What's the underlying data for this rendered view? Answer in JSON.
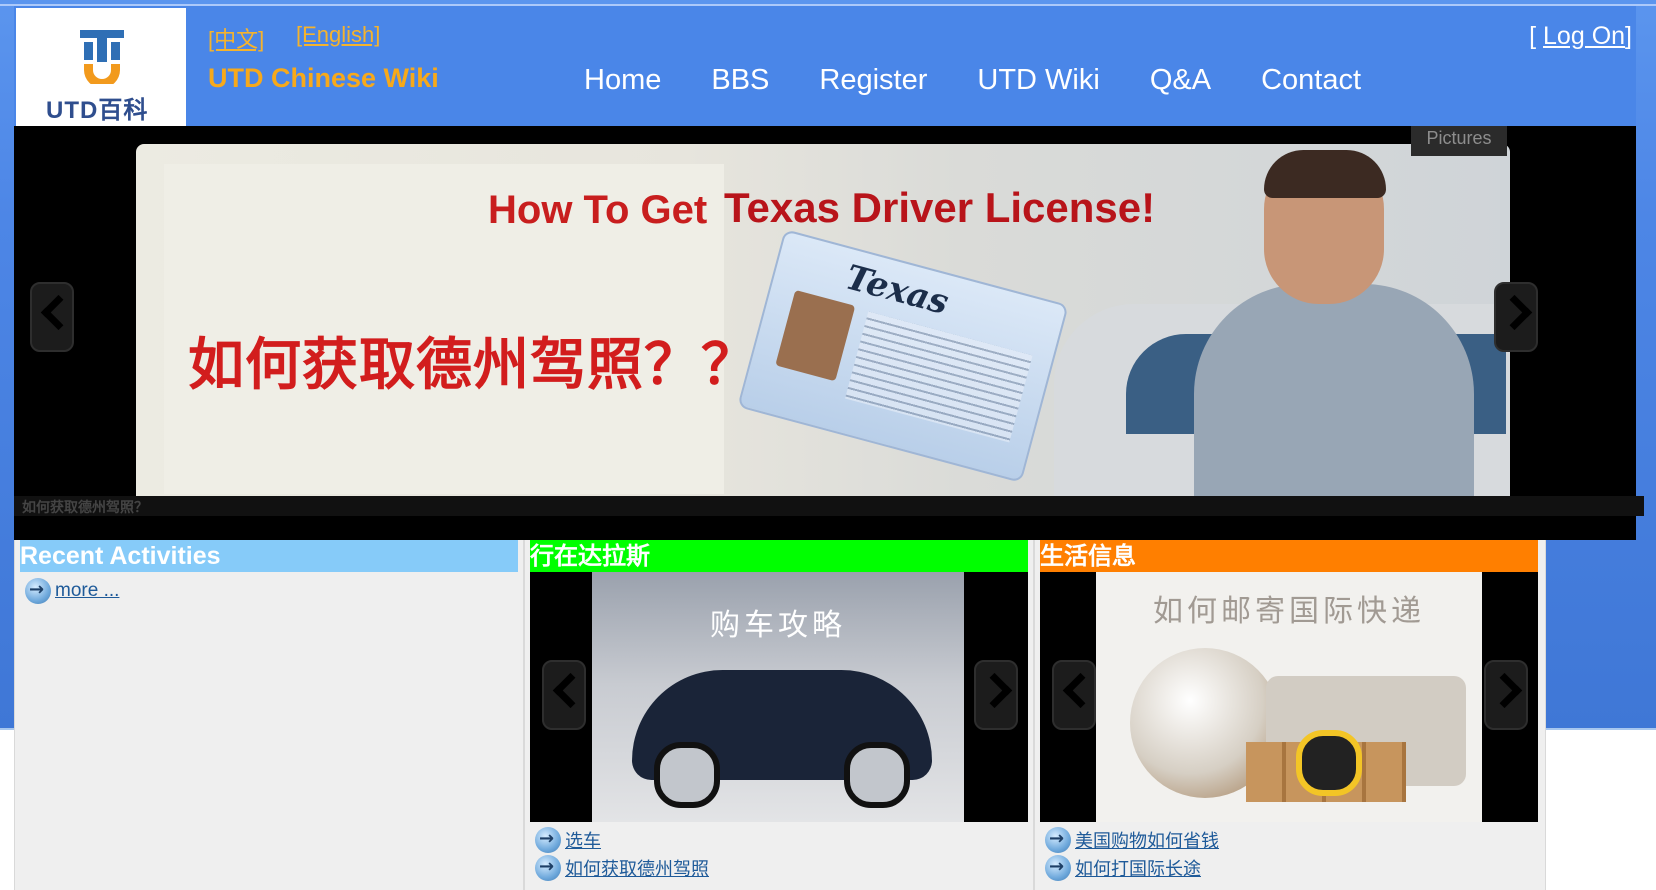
{
  "header": {
    "logo_text": "UTD百科",
    "lang_cn": "[中文]",
    "lang_en": "[English]",
    "site_title": "UTD Chinese Wiki",
    "nav": [
      "Home",
      "BBS",
      "Register",
      "UTD Wiki",
      "Q&A",
      "Contact"
    ],
    "logon_prefix": "[ ",
    "logon_label": "Log On",
    "logon_suffix": "]"
  },
  "slider": {
    "tab": "Pictures",
    "headline_1": "How To Get",
    "headline_2": "Texas Driver License!",
    "headline_cn": "如何获取德州驾照？？",
    "license_text": "Texas",
    "caption": "如何获取德州驾照？"
  },
  "panels": {
    "recent": {
      "title": "Recent Activities",
      "more": "more ..."
    },
    "dallas": {
      "title": "行在达拉斯",
      "image_title": "购车攻略",
      "links": [
        "选车",
        "如何获取德州驾照"
      ]
    },
    "life": {
      "title": "生活信息",
      "image_title": "如何邮寄国际快递",
      "links": [
        "美国购物如何省钱",
        "如何打国际长途"
      ]
    }
  },
  "colors": {
    "header_bg": "#4a86e8",
    "title_orange": "#f7a91b",
    "recent_header": "#86cbf9",
    "dallas_header": "#00ff00",
    "life_header": "#ff7f00"
  }
}
